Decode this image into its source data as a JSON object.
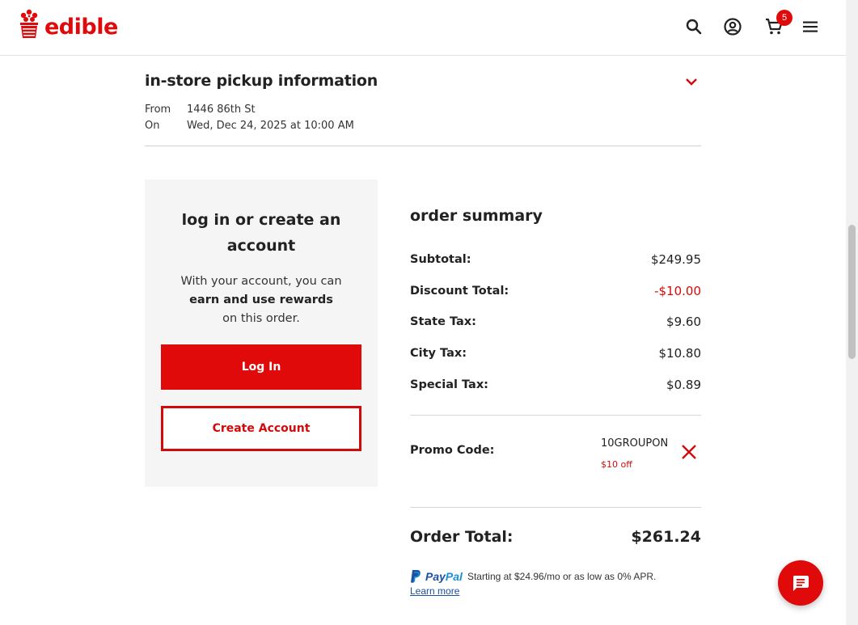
{
  "brand": {
    "name": "edible",
    "color": "#e10a0a"
  },
  "header": {
    "icons": [
      "search-icon",
      "account-icon",
      "cart-icon",
      "menu-icon"
    ],
    "cart_count": "5"
  },
  "pickup": {
    "title": "in-store pickup information",
    "from_label": "From",
    "from_value": "1446 86th St",
    "on_label": "On",
    "on_value": "Wed, Dec 24, 2025 at 10:00 AM"
  },
  "login": {
    "title": "log in or create an account",
    "text_before": "With your account, you can",
    "text_bold": "earn and use rewards",
    "text_after": "on this order.",
    "login_label": "Log In",
    "create_label": "Create Account"
  },
  "summary": {
    "title": "order summary",
    "rows": [
      {
        "label": "Subtotal:",
        "value": "$249.95"
      },
      {
        "label": "Discount Total:",
        "value": "-$10.00"
      },
      {
        "label": "State Tax:",
        "value": "$9.60"
      },
      {
        "label": "City Tax:",
        "value": "$10.80"
      },
      {
        "label": "Special Tax:",
        "value": "$0.89"
      }
    ],
    "promo_label": "Promo Code:",
    "promo_code": "10GROUPON",
    "promo_off": "$10 off",
    "total_label": "Order Total:",
    "total_value": "$261.24"
  },
  "paypal": {
    "brand_a": "Pay",
    "brand_b": "Pal",
    "text": "Starting at $24.96/mo or as low as 0% APR.",
    "learn_more": "Learn more"
  },
  "colors": {
    "accent": "#e10a0a",
    "card_bg": "#f5f5f5",
    "paypal_blue": "#1d4fa3"
  }
}
